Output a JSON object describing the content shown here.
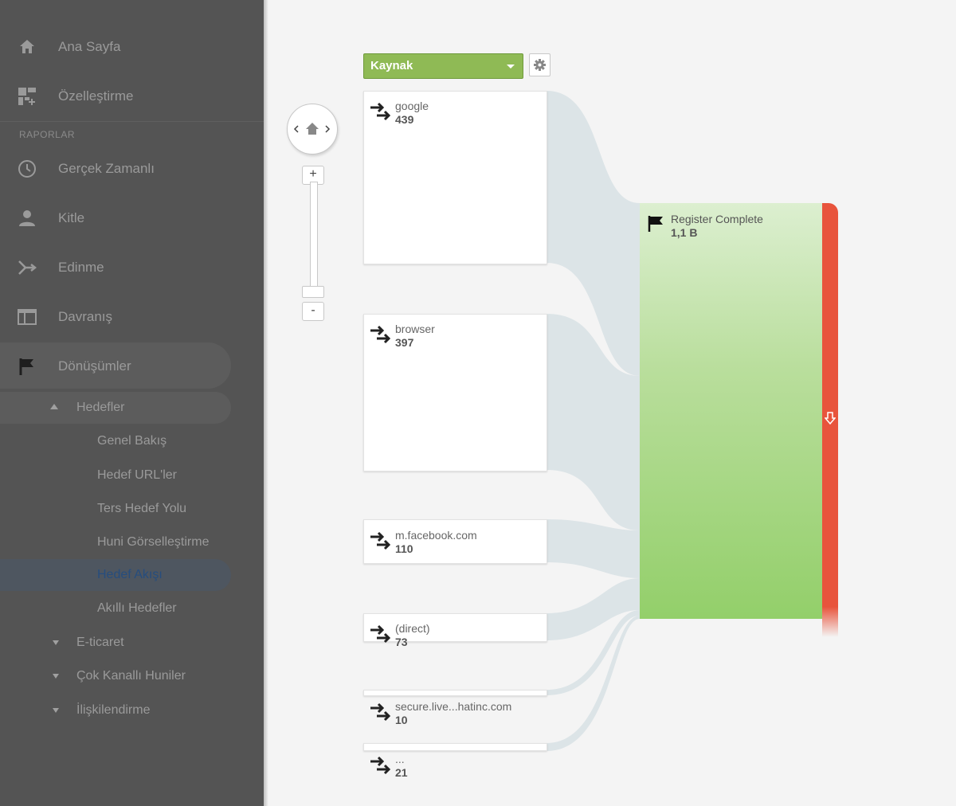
{
  "sidebar": {
    "items": [
      {
        "label": "Ana Sayfa",
        "icon": "home-icon"
      },
      {
        "label": "Özelleştirme",
        "icon": "dashboard-icon"
      }
    ],
    "section_label": "RAPORLAR",
    "reports": [
      {
        "label": "Gerçek Zamanlı",
        "icon": "clock-icon"
      },
      {
        "label": "Kitle",
        "icon": "person-icon"
      },
      {
        "label": "Edinme",
        "icon": "acquisition-icon"
      },
      {
        "label": "Davranış",
        "icon": "behavior-icon"
      },
      {
        "label": "Dönüşümler",
        "icon": "flag-icon"
      }
    ],
    "goals_group": "Hedefler",
    "goals_items": [
      "Genel Bakış",
      "Hedef URL'ler",
      "Ters Hedef Yolu",
      "Huni Görselleştirme",
      "Hedef Akışı",
      "Akıllı Hedefler"
    ],
    "active_item": "Hedef Akışı",
    "collapsed_groups": [
      "E-ticaret",
      "Çok Kanallı Huniler",
      "İlişkilendirme"
    ],
    "accent_active_color": "#264d7e"
  },
  "toolbar": {
    "dimension_selected": "Kaynak",
    "dimension_color": "#8fba55"
  },
  "flow": {
    "sources": [
      {
        "name": "google",
        "value": "439"
      },
      {
        "name": "browser",
        "value": "397"
      },
      {
        "name": "m.facebook.com",
        "value": "110"
      },
      {
        "name": "(direct)",
        "value": "73"
      },
      {
        "name": "secure.live...hatinc.com",
        "value": "10"
      },
      {
        "name": "...",
        "value": "21"
      }
    ],
    "goal": {
      "name": "Register Complete",
      "value": "1,1 B",
      "color": "#93cf6a"
    },
    "dropoff_color": "#e8543c"
  }
}
